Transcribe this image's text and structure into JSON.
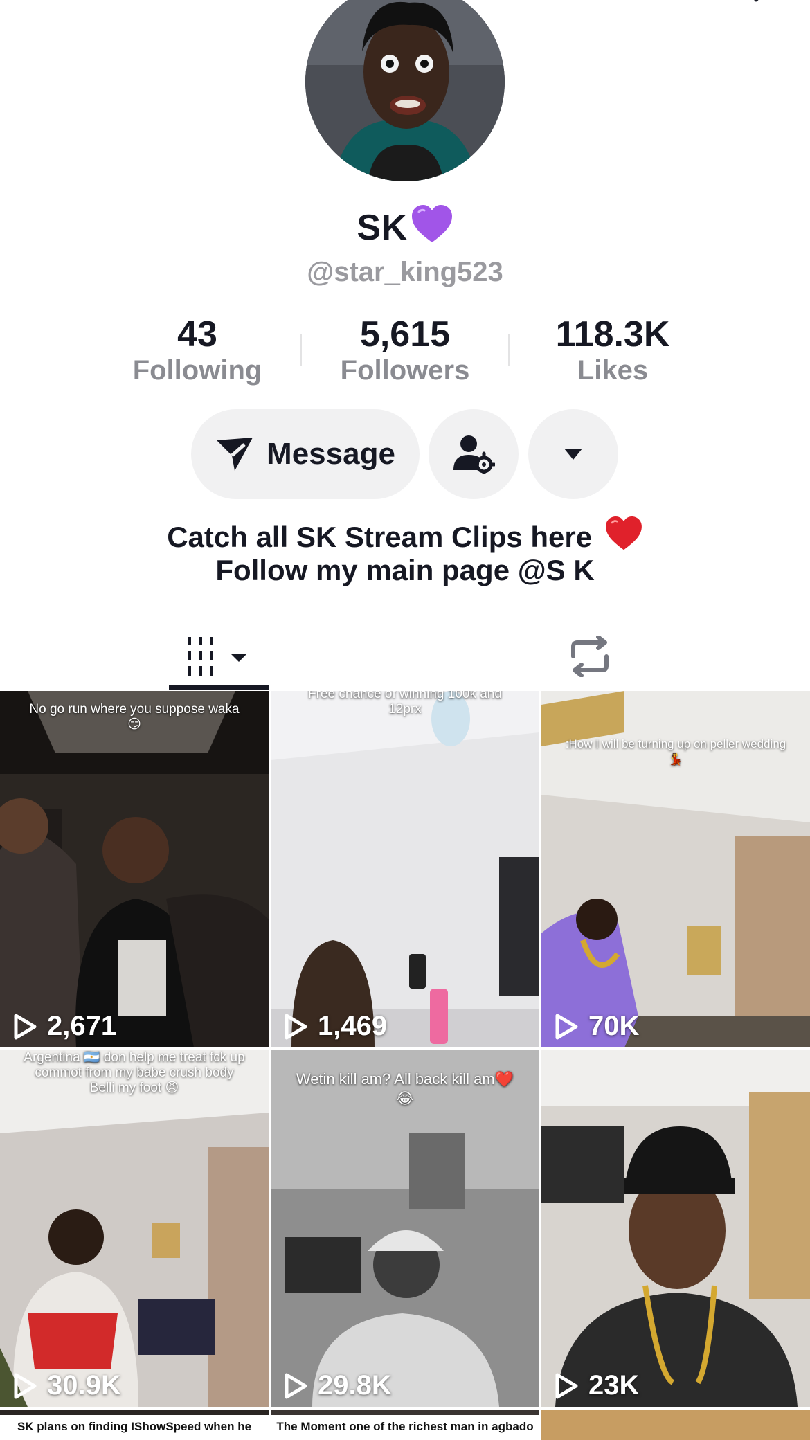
{
  "profile": {
    "display_name": "SK",
    "username": "@star_king523",
    "bio_line1": "Catch all SK Stream Clips here",
    "bio_line2": "Follow my main page @S K"
  },
  "stats": {
    "following": {
      "value": "43",
      "label": "Following"
    },
    "followers": {
      "value": "5,615",
      "label": "Followers"
    },
    "likes": {
      "value": "118.3K",
      "label": "Likes"
    }
  },
  "actions": {
    "message_label": "Message"
  },
  "icons": {
    "back": "back-arrow-icon",
    "bell": "bell-icon",
    "share": "share-icon",
    "message": "send-icon",
    "follow_settings": "person-gear-icon",
    "more": "caret-down-icon",
    "videos_tab": "videos-grid-icon",
    "reposts_tab": "repost-icon",
    "play": "play-icon",
    "name_heart": "purple-heart-emoji",
    "bio_heart": "red-heart-emoji"
  },
  "videos": [
    {
      "caption": "No go run where you suppose waka 😏",
      "views": "2,671"
    },
    {
      "caption": "Free chance of winning 100k and 12prx",
      "views": "1,469"
    },
    {
      "caption": ":How I will be turning up on peller wedding 💃",
      "views": "70K"
    },
    {
      "caption": "Argentina 🇦🇷 don help me treat fck up commot from my babe crush body Belli my foot 😠",
      "views": "30.9K"
    },
    {
      "caption": "Wetin kill am? All back kill am❤️😂",
      "views": "29.8K"
    },
    {
      "caption": "",
      "views": "23K"
    }
  ],
  "next_row_captions": [
    "SK plans on finding IShowSpeed when he comes",
    "The Moment one of the richest man in agbado"
  ],
  "colors": {
    "text_primary": "#161823",
    "text_secondary": "#8a8b91",
    "button_bg": "#f1f1f2",
    "heart_purple": "#a155e8",
    "heart_red": "#e0212b"
  }
}
